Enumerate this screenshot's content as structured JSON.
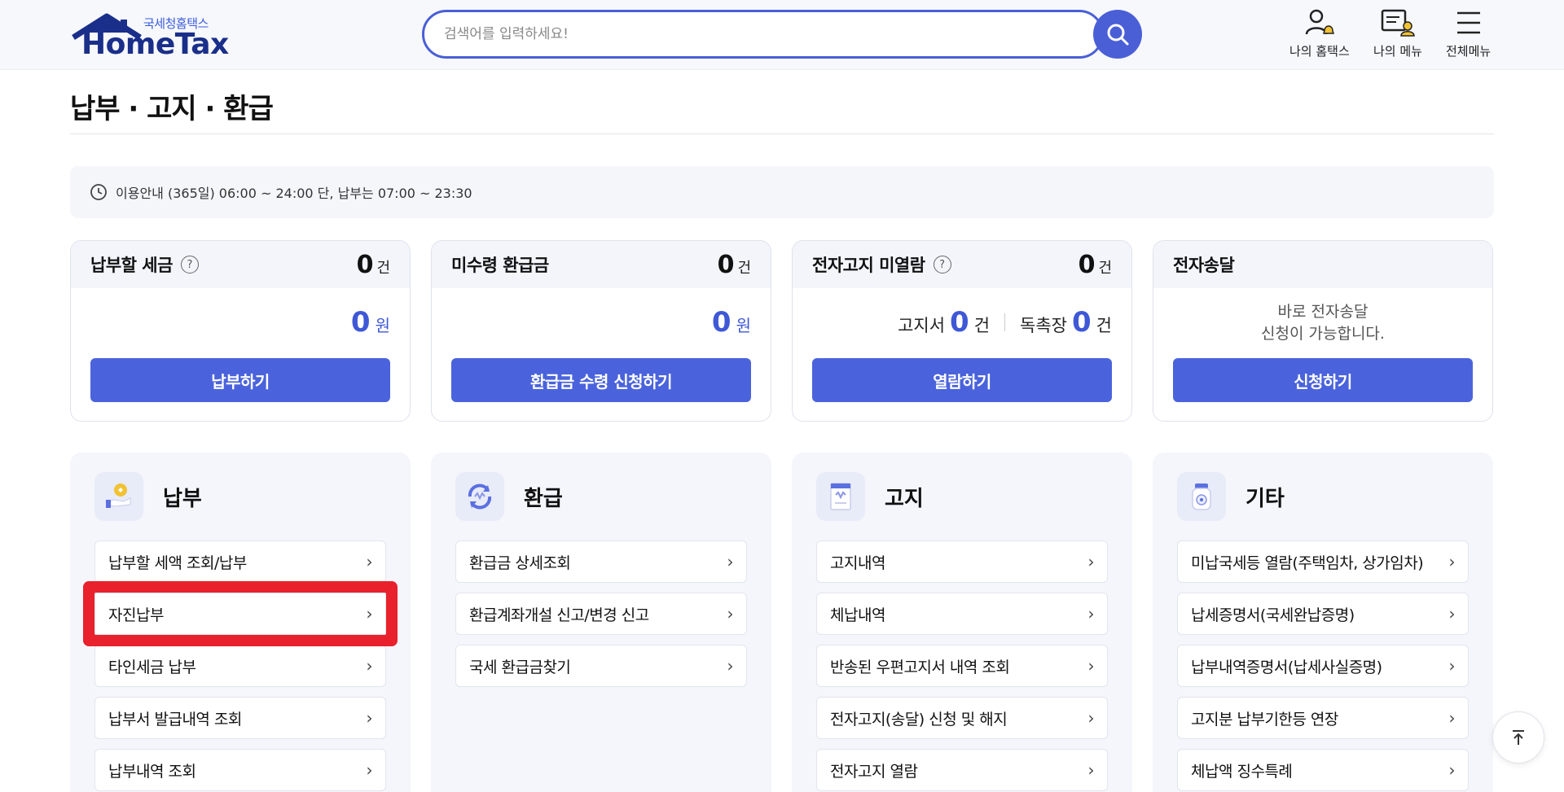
{
  "header": {
    "logo_sub": "국세청홈택스",
    "logo_main": "HomeTax",
    "search_placeholder": "검색어를 입력하세요!",
    "menus": [
      {
        "label": "나의 홈택스",
        "icon": "user-bell-icon"
      },
      {
        "label": "나의 메뉴",
        "icon": "menu-user-icon"
      },
      {
        "label": "전체메뉴",
        "icon": "hamburger-icon"
      }
    ]
  },
  "page": {
    "title": "납부 · 고지 · 환급",
    "notice": "이용안내 (365일) 06:00 ~ 24:00 단, 납부는 07:00 ~ 23:30"
  },
  "cards": [
    {
      "title": "납부할 세금",
      "help": "?",
      "count": "0",
      "count_unit": "건",
      "amount": "0",
      "amount_unit": "원",
      "button": "납부하기"
    },
    {
      "title": "미수령 환급금",
      "count": "0",
      "count_unit": "건",
      "amount": "0",
      "amount_unit": "원",
      "button": "환급금 수령 신청하기"
    },
    {
      "title": "전자고지 미열람",
      "help": "?",
      "count": "0",
      "count_unit": "건",
      "notice_label": "고지서",
      "notice_count": "0",
      "notice_unit": "건",
      "dunning_label": "독촉장",
      "dunning_count": "0",
      "dunning_unit": "건",
      "button": "열람하기"
    },
    {
      "title": "전자송달",
      "desc_line1": "바로 전자송달",
      "desc_line2": "신청이 가능합니다.",
      "button": "신청하기"
    }
  ],
  "panels": [
    {
      "title": "납부",
      "icon": "payment-hand-icon",
      "items": [
        "납부할 세액 조회/납부",
        "자진납부",
        "타인세금 납부",
        "납부서 발급내역 조회",
        "납부내역 조회"
      ]
    },
    {
      "title": "환급",
      "icon": "refund-cycle-icon",
      "items": [
        "환급금 상세조회",
        "환급계좌개설 신고/변경 신고",
        "국세 환급금찾기"
      ]
    },
    {
      "title": "고지",
      "icon": "notice-document-icon",
      "items": [
        "고지내역",
        "체납내역",
        "반송된 우편고지서 내역 조회",
        "전자고지(송달) 신청 및 해지",
        "전자고지 열람"
      ]
    },
    {
      "title": "기타",
      "icon": "jar-icon",
      "items": [
        "미납국세등 열람(주택임차, 상가임차)",
        "납세증명서(국세완납증명)",
        "납부내역증명서(납세사실증명)",
        "고지분 납부기한등 연장",
        "체납액 징수특례"
      ]
    }
  ],
  "colors": {
    "accent": "#4a63dc",
    "brand": "#1a2f8a",
    "highlight": "#e8212c"
  }
}
